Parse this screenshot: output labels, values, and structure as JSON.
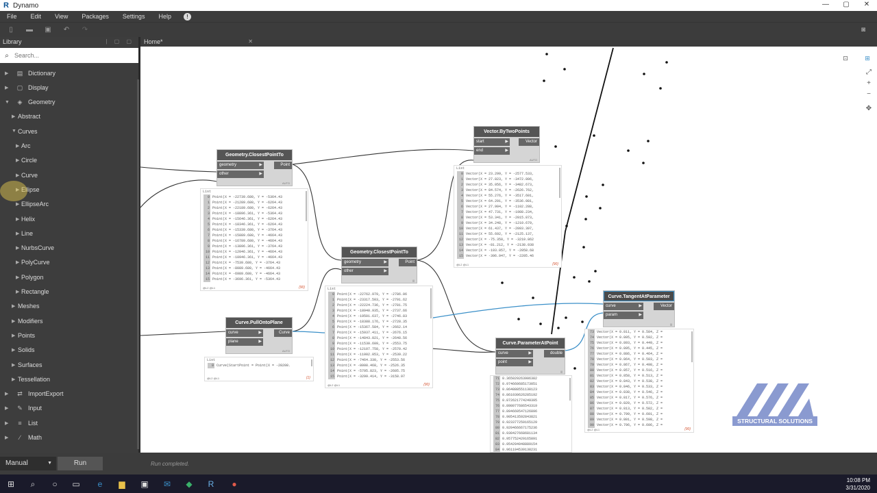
{
  "window": {
    "title": "Dynamo",
    "controls": [
      "—",
      "▢",
      "✕"
    ]
  },
  "menu": [
    "File",
    "Edit",
    "View",
    "Packages",
    "Settings",
    "Help"
  ],
  "library": {
    "title": "Library",
    "search_placeholder": "Search...",
    "items": [
      {
        "label": "Dictionary",
        "level": 0,
        "icon": "▤"
      },
      {
        "label": "Display",
        "level": 0,
        "icon": "▢"
      },
      {
        "label": "Geometry",
        "level": 0,
        "icon": "◈",
        "open": true
      },
      {
        "label": "Abstract",
        "level": 1
      },
      {
        "label": "Curves",
        "level": 1,
        "open": true
      },
      {
        "label": "Arc",
        "level": 2
      },
      {
        "label": "Circle",
        "level": 2
      },
      {
        "label": "Curve",
        "level": 2
      },
      {
        "label": "Ellipse",
        "level": 2
      },
      {
        "label": "EllipseArc",
        "level": 2
      },
      {
        "label": "Helix",
        "level": 2
      },
      {
        "label": "Line",
        "level": 2
      },
      {
        "label": "NurbsCurve",
        "level": 2
      },
      {
        "label": "PolyCurve",
        "level": 2
      },
      {
        "label": "Polygon",
        "level": 2
      },
      {
        "label": "Rectangle",
        "level": 2
      },
      {
        "label": "Meshes",
        "level": 1
      },
      {
        "label": "Modifiers",
        "level": 1
      },
      {
        "label": "Points",
        "level": 1
      },
      {
        "label": "Solids",
        "level": 1
      },
      {
        "label": "Surfaces",
        "level": 1
      },
      {
        "label": "Tessellation",
        "level": 1
      },
      {
        "label": "ImportExport",
        "level": 0,
        "icon": "⇄"
      },
      {
        "label": "Input",
        "level": 0,
        "icon": "✎"
      },
      {
        "label": "List",
        "level": 0,
        "icon": "≡"
      },
      {
        "label": "Math",
        "level": 0,
        "icon": "∕"
      }
    ]
  },
  "tab": {
    "label": "Home*"
  },
  "run": {
    "mode": "Manual",
    "button": "Run",
    "status": "Run completed."
  },
  "clock": {
    "time": "10:08 PM",
    "date": "3/31/2020"
  },
  "watermark": {
    "text": "STRUCTURAL SOLUTIONS"
  },
  "nodes": {
    "closest1": {
      "title": "Geometry.ClosestPointTo",
      "inputs": [
        "geometry",
        "other"
      ],
      "output": "Point",
      "tag": "AUTO"
    },
    "closest2": {
      "title": "Geometry.ClosestPointTo",
      "inputs": [
        "geometry",
        "other"
      ],
      "output": "Point",
      "tag": "|||"
    },
    "vector": {
      "title": "Vector.ByTwoPoints",
      "inputs": [
        "start",
        "end"
      ],
      "output": "Vector",
      "tag": "AUTO"
    },
    "pull": {
      "title": "Curve.PullOntoPlane",
      "inputs": [
        "curve",
        "plane"
      ],
      "output": "Curve",
      "tag": "AUTO"
    },
    "param": {
      "title": "Curve.ParameterAtPoint",
      "inputs": [
        "curve",
        "point"
      ],
      "output": "double",
      "tag": "|||"
    },
    "tangent": {
      "title": "Curve.TangentAtParameter",
      "inputs": [
        "curve",
        "param"
      ],
      "output": "Vector",
      "tag": "|||"
    }
  },
  "previews": {
    "p1": {
      "header": "List",
      "footer": "@L2 @L1",
      "count": "{90}",
      "rows": [
        [
          "0",
          "Point(X = -22739.680, Y = -5364.43"
        ],
        [
          "1",
          "Point(X = -21289.680, Y = -6264.43"
        ],
        [
          "2",
          "Point(X = -22189.680, Y = -6264.43"
        ],
        [
          "3",
          "Point(X = -18896.361, Y = -5364.43"
        ],
        [
          "4",
          "Point(X = -15646.361, Y = -6264.43"
        ],
        [
          "5",
          "Point(X = -18346.361, Y = -6264.43"
        ],
        [
          "6",
          "Point(X = -15339.680, Y = -3764.43"
        ],
        [
          "7",
          "Point(X = -15889.680, Y = -4664.43"
        ],
        [
          "8",
          "Point(X = -16789.680, Y = -4664.43"
        ],
        [
          "9",
          "Point(X = -13896.361, Y = -3764.43"
        ],
        [
          "10",
          "Point(X = -12046.361, Y = -4664.43"
        ],
        [
          "11",
          "Point(X = -10946.361, Y = -4664.43"
        ],
        [
          "12",
          "Point(X = -7539.680, Y = -3764.43"
        ],
        [
          "13",
          "Point(X = -8089.680, Y = -4664.43"
        ],
        [
          "14",
          "Point(X = -6989.680, Y = -4664.43"
        ],
        [
          "15",
          "Point(X = -3696.361, Y = -5364.43"
        ]
      ]
    },
    "p2": {
      "header": "List",
      "footer": "@L2 @L1",
      "count": "{90}",
      "rows": [
        [
          "0",
          "Point(X = -22762.979, Y = -2786.06"
        ],
        [
          "1",
          "Point(X = -23317.503, Y = -2791.62"
        ],
        [
          "2",
          "Point(X = -22224.736, Y = -2781.75"
        ],
        [
          "3",
          "Point(X = -18940.935, Y = -2737.66"
        ],
        [
          "4",
          "Point(X = -19501.637, Y = -2746.83"
        ],
        [
          "5",
          "Point(X = -18388.176, Y = -2728.35"
        ],
        [
          "6",
          "Point(X = -15367.584, Y = -2662.14"
        ],
        [
          "7",
          "Point(X = -15937.411, Y = -2676.15"
        ],
        [
          "8",
          "Point(X = -14843.021, Y = -2648.56"
        ],
        [
          "9",
          "Point(X = -11530.609, Y = -2553.75"
        ],
        [
          "10",
          "Point(X = -12107.758, Y = -2570.42"
        ],
        [
          "11",
          "Point(X = -11002.053, Y = -2539.22"
        ],
        [
          "12",
          "Point(X = -7464.330, Y = -2553.56"
        ],
        [
          "13",
          "Point(X = -8008.468, Y = -2526.35"
        ],
        [
          "14",
          "Point(X = -5795.823, Y = -2605.75"
        ],
        [
          "15",
          "Point(X = -3299.414, Y = -3158.97"
        ]
      ]
    },
    "p3": {
      "header": "List",
      "footer": "@L2 @L1",
      "count": "{90}",
      "rows": [
        [
          "0",
          "Vector(X = 23.299, Y = -2577.533,"
        ],
        [
          "1",
          "Vector(X = 27.823, Y = -3472.806,"
        ],
        [
          "2",
          "Vector(X = 35.056, Y = -3482.673,"
        ],
        [
          "3",
          "Vector(X = 84.574, Y = -2626.762,"
        ],
        [
          "4",
          "Vector(X = 55.276, Y = -3517.601,"
        ],
        [
          "5",
          "Vector(X = 64.291, Y = -3536.081,"
        ],
        [
          "6",
          "Vector(X = 27.904, Y = -1102.288,"
        ],
        [
          "7",
          "Vector(X = 47.731, Y = -1988.234,"
        ],
        [
          "8",
          "Vector(X = 53.341, Y = -2015.873,"
        ],
        [
          "9",
          "Vector(X = 34.248, Y = -1210.679,"
        ],
        [
          "10",
          "Vector(X = 61.437, Y = -2093.397,"
        ],
        [
          "11",
          "Vector(X = 55.692, Y = -2125.137,"
        ],
        [
          "12",
          "Vector(X = -75.350, Y = -3210.862"
        ],
        [
          "13",
          "Vector(X = -81.212, Y = -2138.038"
        ],
        [
          "14",
          "Vector(X = -193.057, Y = -2058.68"
        ],
        [
          "15",
          "Vector(X = -396.947, Y = -2205.46"
        ]
      ]
    },
    "p4": {
      "header": "List",
      "footer": "@L2 @L1",
      "count": "{1}",
      "rows": [
        [
          "0",
          "Curve(StartPoint = Point(X = -28208."
        ]
      ]
    },
    "p5": {
      "header": "",
      "footer": "",
      "count": "",
      "rows": [
        [
          "71",
          "0.365029263906382"
        ],
        [
          "72",
          "0.974660685173051"
        ],
        [
          "73",
          "0.864888551138123"
        ],
        [
          "74",
          "0.861030626285192"
        ],
        [
          "75",
          "0.872621774249395"
        ],
        [
          "76",
          "0.898077686543319"
        ],
        [
          "77",
          "0.894660547126896"
        ],
        [
          "78",
          "0.905413592843821"
        ],
        [
          "79",
          "0.923377259165129"
        ],
        [
          "80",
          "0.920466667175236"
        ],
        [
          "81",
          "0.930427668681134"
        ],
        [
          "82",
          "0.957752429165891"
        ],
        [
          "83",
          "0.954294948889154"
        ],
        [
          "84",
          "0.961194539138231"
        ]
      ]
    },
    "p6": {
      "header": "",
      "footer": "@L2 @L1",
      "count": "{90}",
      "rows": [
        [
          "73",
          "Vector(X = 0.811, Y = 0.584, Z ="
        ],
        [
          "74",
          "Vector(X = 0.805, Y = 0.592, Z ="
        ],
        [
          "75",
          "Vector(X = 0.893, Y = 0.449, Z ="
        ],
        [
          "76",
          "Vector(X = 0.895, Y = 0.445, Z ="
        ],
        [
          "77",
          "Vector(X = 0.886, Y = 0.464, Z ="
        ],
        [
          "78",
          "Vector(X = 0.864, Y = 0.503, Z ="
        ],
        [
          "79",
          "Vector(X = 0.867, Y = 0.498, Z ="
        ],
        [
          "80",
          "Vector(X = 0.857, Y = 0.516, Z ="
        ],
        [
          "81",
          "Vector(X = 0.858, Y = 0.513, Z ="
        ],
        [
          "82",
          "Vector(X = 0.843, Y = 0.538, Z ="
        ],
        [
          "83",
          "Vector(X = 0.846, Y = 0.533, Z ="
        ],
        [
          "84",
          "Vector(X = 0.838, Y = 0.546, Z ="
        ],
        [
          "85",
          "Vector(X = 0.817, Y = 0.576, Z ="
        ],
        [
          "86",
          "Vector(X = 0.820, Y = 0.572, Z ="
        ],
        [
          "87",
          "Vector(X = 0.813, Y = 0.582, Z ="
        ],
        [
          "88",
          "Vector(X = 0.799, Y = 0.601, Z ="
        ],
        [
          "89",
          "Vector(X = 0.801, Y = 0.598, Z ="
        ],
        [
          "90",
          "Vector(X = 0.796, Y = 0.606, Z ="
        ]
      ]
    }
  },
  "colors": {
    "accent_wire": "#3a8fc8",
    "wire": "#333333",
    "node_header": "#555555"
  }
}
